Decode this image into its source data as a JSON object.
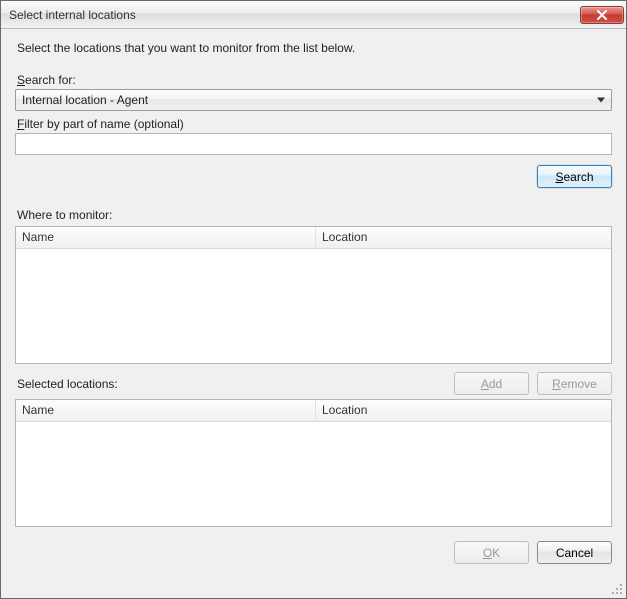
{
  "window": {
    "title": "Select internal locations"
  },
  "instruction": "Select the locations that you want to monitor from the list below.",
  "search": {
    "label_prefix": "S",
    "label_rest": "earch for:",
    "selected": "Internal location - Agent",
    "filter_label_prefix": "F",
    "filter_label_rest": "ilter by part of name (optional)",
    "filter_value": "",
    "button_prefix": "S",
    "button_rest": "earch"
  },
  "monitor": {
    "label": "Where to monitor:",
    "columns": {
      "name": "Name",
      "location": "Location"
    }
  },
  "actions": {
    "add_prefix": "A",
    "add_rest": "dd",
    "remove_prefix": "R",
    "remove_rest": "emove"
  },
  "selected": {
    "label": "Selected locations:",
    "columns": {
      "name": "Name",
      "location": "Location"
    }
  },
  "footer": {
    "ok_prefix": "O",
    "ok_rest": "K",
    "cancel": "Cancel"
  }
}
